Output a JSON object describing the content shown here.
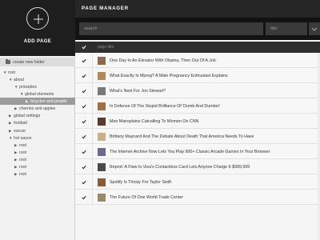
{
  "sidebar": {
    "add_label": "ADD PAGE",
    "create_folder_label": "create new folder",
    "tree": [
      {
        "label": "root",
        "arrow": "▼",
        "level": 0,
        "selected": false
      },
      {
        "label": "about",
        "arrow": "▼",
        "level": 1,
        "selected": false
      },
      {
        "label": "principles",
        "arrow": "▼",
        "level": 2,
        "selected": false
      },
      {
        "label": "global elements",
        "arrow": "▼",
        "level": 3,
        "selected": false
      },
      {
        "label": "bicycles and people",
        "arrow": "▶",
        "level": 4,
        "selected": true
      },
      {
        "label": "cherries and apples",
        "arrow": "▶",
        "level": 2,
        "selected": false
      },
      {
        "label": "global settings",
        "arrow": "▶",
        "level": 1,
        "selected": false
      },
      {
        "label": "football",
        "arrow": "▶",
        "level": 1,
        "selected": false
      },
      {
        "label": "soccer",
        "arrow": "▶",
        "level": 1,
        "selected": false
      },
      {
        "label": "hot sauce",
        "arrow": "▼",
        "level": 1,
        "selected": false
      },
      {
        "label": "root",
        "arrow": "▶",
        "level": 2,
        "selected": false
      },
      {
        "label": "root",
        "arrow": "▶",
        "level": 2,
        "selected": false
      },
      {
        "label": "root",
        "arrow": "▶",
        "level": 2,
        "selected": false
      },
      {
        "label": "root",
        "arrow": "▶",
        "level": 2,
        "selected": false
      },
      {
        "label": "root",
        "arrow": "▶",
        "level": 2,
        "selected": false
      }
    ]
  },
  "header": {
    "title": "PAGE MANAGER",
    "search_placeholder": "search",
    "sort_value": "title"
  },
  "table": {
    "column_title": "page title",
    "rows": [
      {
        "title": "One Day In An Elevator With Obama, Then Out Of A Job",
        "checked": true,
        "thumb_color": "#8a6a4a"
      },
      {
        "title": "What Exactly Is Mpreg? A Male Pregnancy Enthusiast Explains",
        "checked": true,
        "thumb_color": "#b48a5a"
      },
      {
        "title": "What's Next For Jon Stewart?",
        "checked": true,
        "thumb_color": "#7a7a7a"
      },
      {
        "title": "In Defense Of The Stupid Brilliance Of 'Dumb And Dumber'",
        "checked": true,
        "thumb_color": "#a07040"
      },
      {
        "title": "Man Mansplains Catcalling To Women On CNN",
        "checked": true,
        "thumb_color": "#5a3a2a"
      },
      {
        "title": "Brittany Maynard And The Debate About Death That America Needs To Have",
        "checked": true,
        "thumb_color": "#c9b08a"
      },
      {
        "title": "The Internet Archive Now Lets You Play 900+ Classic Arcade Games In Your Browser",
        "checked": true,
        "thumb_color": "#6a6a8a"
      },
      {
        "title": "Report: A Flaw In Visa's Contactless Card Lets Anyone Charge It $999,999",
        "checked": true,
        "thumb_color": "#4a4a4a"
      },
      {
        "title": "Spotify Is Thirsty For Taylor Swift",
        "checked": true,
        "thumb_color": "#8a5a3a"
      },
      {
        "title": "The Future Of One World Trade Center",
        "checked": true,
        "thumb_color": "#9a8a6a"
      }
    ]
  }
}
